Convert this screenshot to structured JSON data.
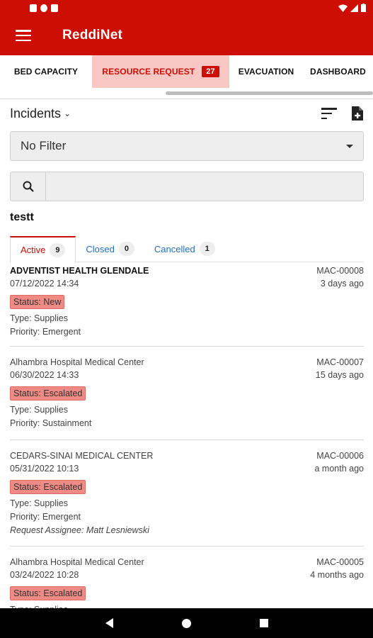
{
  "app": {
    "title": "ReddiNet"
  },
  "top_tabs": [
    {
      "label": "BED CAPACITY"
    },
    {
      "label": "RESOURCE REQUEST",
      "badge": "27"
    },
    {
      "label": "EVACUATION"
    },
    {
      "label": "DASHBOARD"
    }
  ],
  "incidents": {
    "label": "Incidents",
    "filter_value": "No Filter",
    "search_placeholder": ""
  },
  "group_name": "testt",
  "status_tabs": [
    {
      "label": "Active",
      "count": "9"
    },
    {
      "label": "Closed",
      "count": "0"
    },
    {
      "label": "Cancelled",
      "count": "1"
    }
  ],
  "requests": [
    {
      "hospital": "ADVENTIST HEALTH GLENDALE",
      "id": "MAC-00008",
      "datetime": "07/12/2022 14:34",
      "ago": "3 days ago",
      "status": "Status: New",
      "type": "Type: Supplies",
      "priority": "Priority: Emergent"
    },
    {
      "hospital": "Alhambra Hospital Medical Center",
      "id": "MAC-00007",
      "datetime": "06/30/2022 14:33",
      "ago": "15 days ago",
      "status": "Status: Escalated",
      "type": "Type: Supplies",
      "priority": "Priority: Sustainment"
    },
    {
      "hospital": "CEDARS-SINAI MEDICAL CENTER",
      "id": "MAC-00006",
      "datetime": "05/31/2022 10:13",
      "ago": "a month ago",
      "status": "Status: Escalated",
      "type": "Type: Supplies",
      "priority": "Priority: Emergent",
      "assignee": "Request Assignee: Matt Lesniewski"
    },
    {
      "hospital": "Alhambra Hospital Medical Center",
      "id": "MAC-00005",
      "datetime": "03/24/2022 10:28",
      "ago": "4 months ago",
      "status": "Status: Escalated",
      "type": "Type: Supplies"
    }
  ],
  "colors": {
    "brand_red": "#cc0e05",
    "active_tab_bg": "#f8c7c4",
    "status_badge": "#f08a85",
    "link_blue": "#1e6fc8"
  }
}
